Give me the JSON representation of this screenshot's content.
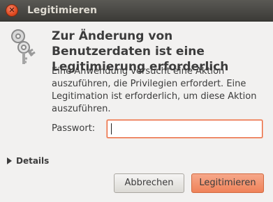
{
  "window": {
    "title": "Legitimieren",
    "close_glyph": "✕"
  },
  "dialog": {
    "icon": "keys-icon",
    "heading": "Zur Änderung von Benutzerdaten ist eine Legitimierung erforderlich",
    "message": "Eine Anwendung versucht eine Aktion auszuführen, die Privilegien erfordert. Eine Legitimation ist erforderlich, um diese Aktion auszuführen.",
    "password_label": "Passwort:",
    "password_value": "",
    "details_label": "Details"
  },
  "buttons": {
    "cancel": "Abbrechen",
    "authenticate": "Legitimieren"
  },
  "colors": {
    "titlebar": "#3c3b37",
    "accent": "#ef8259",
    "focus_border": "#e9643a",
    "background": "#f2f1f0"
  }
}
